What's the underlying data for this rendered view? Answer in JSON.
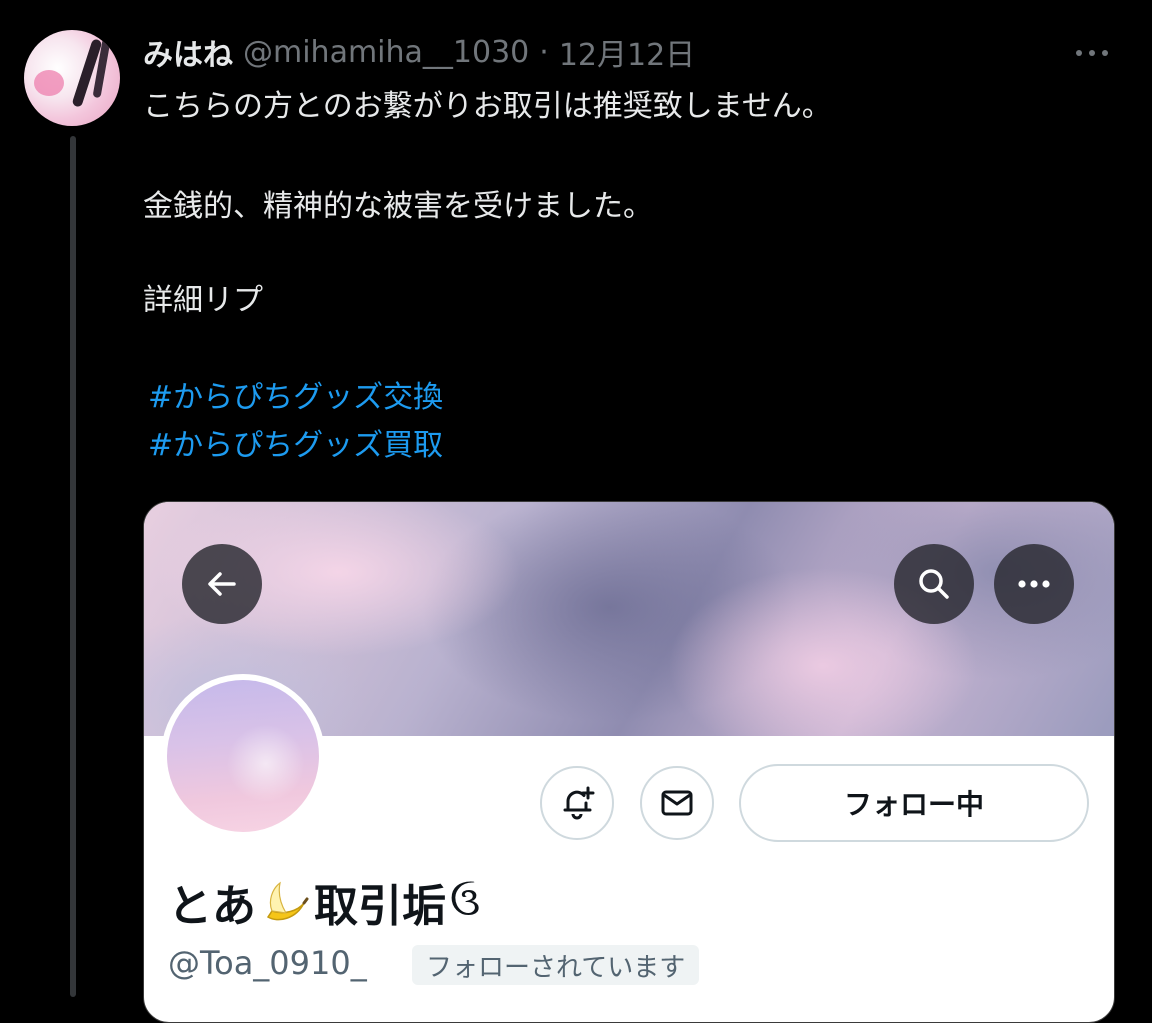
{
  "tweet": {
    "display_name": "みはね",
    "handle": "@mihamiha__1030",
    "separator": "·",
    "timestamp": "12月12日",
    "more_icon": "more-horizontal-icon",
    "lines": [
      "こちらの方とのお繋がりお取引は推奨致しません。",
      "金銭的、精神的な被害を受けました。",
      "詳細リプ"
    ],
    "hashtags": [
      "#からぴちグッズ交換",
      "#からぴちグッズ買取"
    ]
  },
  "embedded_profile": {
    "back_icon": "arrow-left-icon",
    "search_icon": "search-icon",
    "menu_icon": "more-horizontal-icon",
    "notify_icon": "bell-plus-icon",
    "mail_icon": "mail-icon",
    "follow_button": "フォロー中",
    "name_prefix": "とあ",
    "name_emoji_icon": "banana-icon",
    "name_suffix": "取引垢",
    "name_glyph": "ઉ",
    "handle": "@Toa_0910_",
    "follows_you_badge": "フォローされています"
  },
  "colors": {
    "background": "#000000",
    "text_primary": "#e7e9ea",
    "text_secondary": "#71767b",
    "link": "#1d9bf0",
    "card_background": "#ffffff",
    "card_text": "#0f1419",
    "card_secondary": "#536471"
  }
}
